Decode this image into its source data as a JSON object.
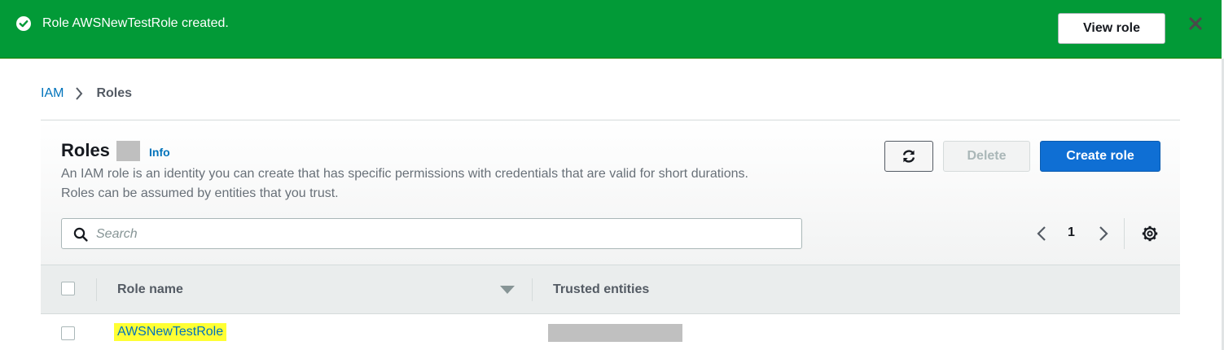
{
  "banner": {
    "message": "Role AWSNewTestRole created.",
    "view_button": "View role",
    "color": "#029a37"
  },
  "breadcrumb": {
    "items": [
      "IAM",
      "Roles"
    ]
  },
  "roles_panel": {
    "title": "Roles",
    "info_link": "Info",
    "description": "An IAM role is an identity you can create that has specific permissions with credentials that are valid for short durations. Roles can be assumed by entities that you trust.",
    "buttons": {
      "refresh_icon": "refresh-icon",
      "delete": "Delete",
      "create": "Create role"
    },
    "search": {
      "placeholder": "Search",
      "value": ""
    },
    "pagination": {
      "current_page": "1"
    },
    "table": {
      "columns": [
        "Role name",
        "Trusted entities"
      ],
      "rows": [
        {
          "role_name": "AWSNewTestRole"
        }
      ]
    }
  },
  "colors": {
    "accent": "#0073bb",
    "primary_button": "#0f6fd4",
    "success": "#029a37",
    "highlight": "#ffff33"
  }
}
